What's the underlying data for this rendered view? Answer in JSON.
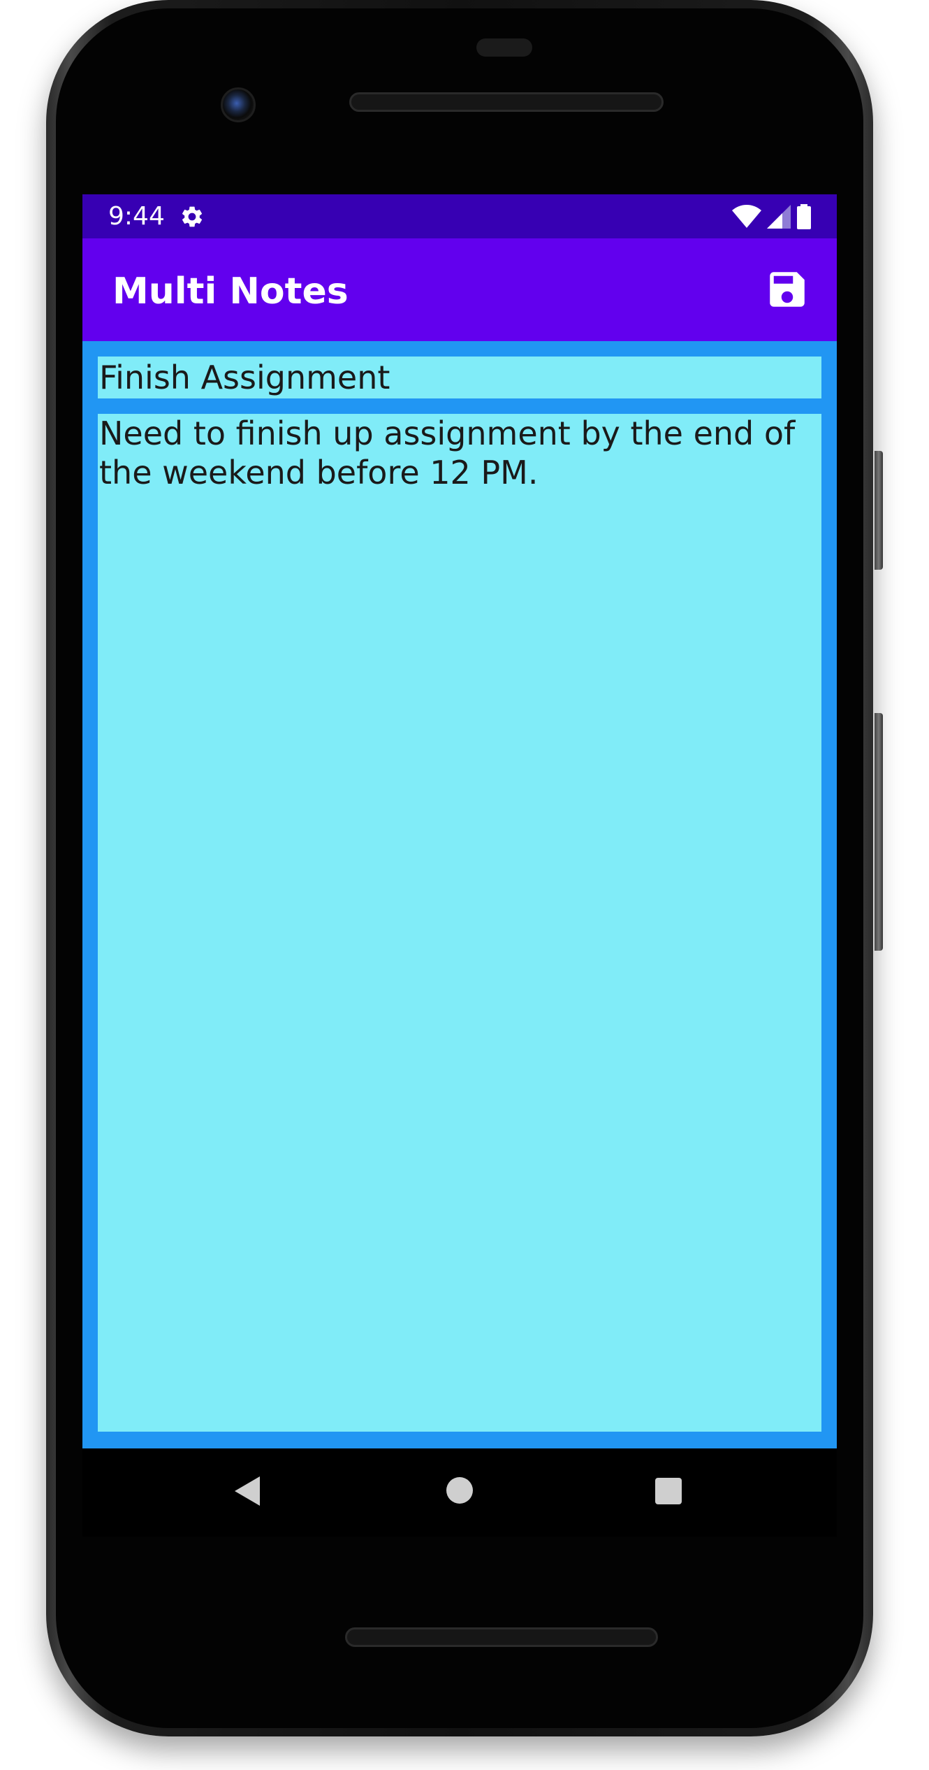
{
  "status_bar": {
    "time": "9:44",
    "icons": [
      "settings-gear-icon",
      "wifi-icon",
      "cellular-signal-icon",
      "battery-icon"
    ]
  },
  "app_bar": {
    "title": "Multi Notes",
    "save_icon": "save-floppy-icon"
  },
  "note": {
    "title": "Finish Assignment",
    "body": "Need to finish up assignment by the end of the weekend before 12 PM."
  },
  "nav_bar": {
    "icons": [
      "back-icon",
      "home-icon",
      "recents-icon"
    ]
  },
  "colors": {
    "status_bar": "#3700B3",
    "app_bar": "#6200EE",
    "content_background": "#2196F3",
    "field_background": "#80ECF8",
    "text": "#1a1a1a"
  }
}
